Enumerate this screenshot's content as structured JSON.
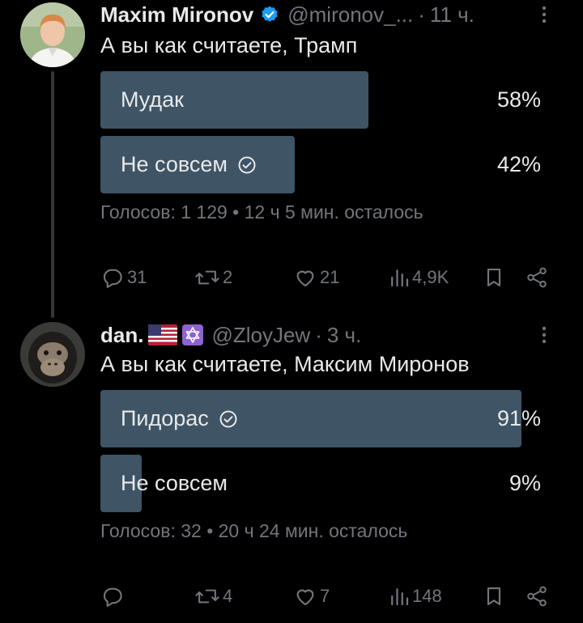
{
  "colors": {
    "background": "#000000",
    "text": "#e7e9ea",
    "muted": "#71767b",
    "poll_bar": "#3f5465",
    "verified": "#1d9bf0"
  },
  "tweets": [
    {
      "author_name": "Maxim Mironov",
      "handle": "@mironov_...",
      "separator": "·",
      "time": "11 ч.",
      "text": "А вы как считаете, Трамп",
      "poll": {
        "options": [
          {
            "label": "Мудак",
            "percent_text": "58%",
            "percent": 58,
            "selected": false
          },
          {
            "label": "Не совсем",
            "percent_text": "42%",
            "percent": 42,
            "selected": true
          }
        ],
        "meta": "Голосов: 1 129 • 12 ч 5 мин. осталось"
      },
      "actions": {
        "replies": "31",
        "reposts": "2",
        "likes": "21",
        "views": "4,9K"
      }
    },
    {
      "author_name": "dan.",
      "handle": "@ZloyJew",
      "separator": "·",
      "time": "3 ч.",
      "text": "А вы как считаете, Максим Миронов",
      "poll": {
        "options": [
          {
            "label": "Пидорас",
            "percent_text": "91%",
            "percent": 91,
            "selected": true
          },
          {
            "label": "Не совсем",
            "percent_text": "9%",
            "percent": 9,
            "selected": false
          }
        ],
        "meta": "Голосов: 32 • 20 ч 24 мин. осталось"
      },
      "actions": {
        "replies": "",
        "reposts": "4",
        "likes": "7",
        "views": "148"
      }
    }
  ]
}
